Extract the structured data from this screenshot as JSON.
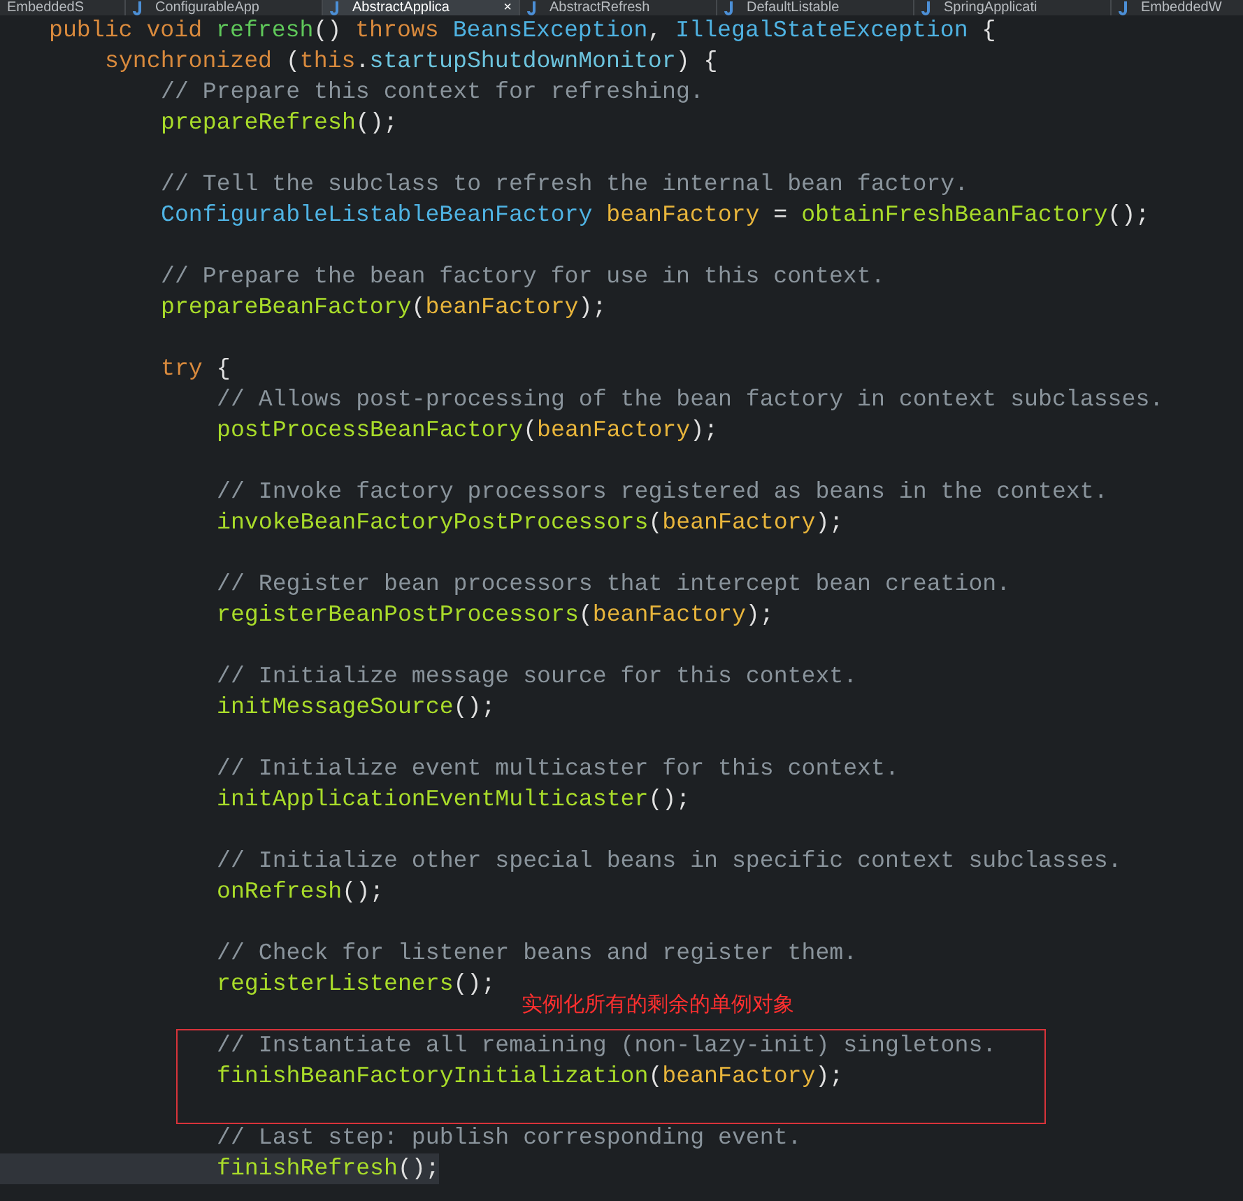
{
  "tabs": [
    {
      "label": "EmbeddedS",
      "selected": false
    },
    {
      "label": "ConfigurableApp",
      "selected": false
    },
    {
      "label": "AbstractApplica",
      "selected": true,
      "close": "×"
    },
    {
      "label": "AbstractRefresh",
      "selected": false
    },
    {
      "label": "DefaultListable",
      "selected": false
    },
    {
      "label": "SpringApplicati",
      "selected": false
    },
    {
      "label": "EmbeddedW",
      "selected": false
    }
  ],
  "annotation": {
    "note": "实例化所有的剩余的单例对象"
  },
  "lines": [
    {
      "kind": "code",
      "current": false,
      "boxed": false,
      "tokens": [
        {
          "kind": "keyword",
          "text": "public void "
        },
        {
          "kind": "declaration",
          "text": "refresh"
        },
        {
          "kind": "plain",
          "text": "() "
        },
        {
          "kind": "keyword",
          "text": "throws "
        },
        {
          "kind": "type",
          "text": "BeansException"
        },
        {
          "kind": "plain",
          "text": ", "
        },
        {
          "kind": "type",
          "text": "IllegalStateException"
        },
        {
          "kind": "plain",
          "text": " {"
        }
      ],
      "children": [
        {
          "kind": "code",
          "current": false,
          "boxed": false,
          "tokens": [
            {
              "kind": "keyword",
              "text": "synchronized"
            },
            {
              "kind": "plain",
              "text": " ("
            },
            {
              "kind": "keyword",
              "text": "this"
            },
            {
              "kind": "plain",
              "text": "."
            },
            {
              "kind": "field",
              "text": "startupShutdownMonitor"
            },
            {
              "kind": "plain",
              "text": ") {"
            }
          ],
          "children": [
            {
              "kind": "code",
              "current": false,
              "boxed": false,
              "tokens": [
                {
                  "kind": "comment",
                  "text": "// Prepare this context for refreshing."
                }
              ]
            },
            {
              "kind": "code",
              "current": false,
              "boxed": false,
              "tokens": [
                {
                  "kind": "method",
                  "text": "prepareRefresh"
                },
                {
                  "kind": "plain",
                  "text": "();"
                }
              ]
            },
            {
              "kind": "blank",
              "current": false,
              "boxed": false
            },
            {
              "kind": "code",
              "current": false,
              "boxed": false,
              "tokens": [
                {
                  "kind": "comment",
                  "text": "// Tell the subclass to refresh the internal bean factory."
                }
              ]
            },
            {
              "kind": "code",
              "current": false,
              "boxed": false,
              "tokens": [
                {
                  "kind": "type",
                  "text": "ConfigurableListableBeanFactory "
                },
                {
                  "kind": "variable",
                  "text": "beanFactory"
                },
                {
                  "kind": "plain",
                  "text": " = "
                },
                {
                  "kind": "method",
                  "text": "obtainFreshBeanFactory"
                },
                {
                  "kind": "plain",
                  "text": "();"
                }
              ]
            },
            {
              "kind": "blank",
              "current": false,
              "boxed": false
            },
            {
              "kind": "code",
              "current": false,
              "boxed": false,
              "tokens": [
                {
                  "kind": "comment",
                  "text": "// Prepare the bean factory for use in this context."
                }
              ]
            },
            {
              "kind": "code",
              "current": false,
              "boxed": false,
              "tokens": [
                {
                  "kind": "method",
                  "text": "prepareBeanFactory"
                },
                {
                  "kind": "plain",
                  "text": "("
                },
                {
                  "kind": "variable",
                  "text": "beanFactory"
                },
                {
                  "kind": "plain",
                  "text": ");"
                }
              ]
            },
            {
              "kind": "blank",
              "current": false,
              "boxed": false
            },
            {
              "kind": "code",
              "current": false,
              "boxed": false,
              "tokens": [
                {
                  "kind": "keyword",
                  "text": "try"
                },
                {
                  "kind": "plain",
                  "text": " {"
                }
              ],
              "children": [
                {
                  "kind": "code",
                  "current": false,
                  "boxed": false,
                  "tokens": [
                    {
                      "kind": "comment",
                      "text": "// Allows post-processing of the bean factory in context subclasses."
                    }
                  ]
                },
                {
                  "kind": "code",
                  "current": false,
                  "boxed": false,
                  "tokens": [
                    {
                      "kind": "method",
                      "text": "postProcessBeanFactory"
                    },
                    {
                      "kind": "plain",
                      "text": "("
                    },
                    {
                      "kind": "variable",
                      "text": "beanFactory"
                    },
                    {
                      "kind": "plain",
                      "text": ");"
                    }
                  ]
                },
                {
                  "kind": "blank",
                  "current": false,
                  "boxed": false
                },
                {
                  "kind": "code",
                  "current": false,
                  "boxed": false,
                  "tokens": [
                    {
                      "kind": "comment",
                      "text": "// Invoke factory processors registered as beans in the context."
                    }
                  ]
                },
                {
                  "kind": "code",
                  "current": false,
                  "boxed": false,
                  "tokens": [
                    {
                      "kind": "method",
                      "text": "invokeBeanFactoryPostProcessors"
                    },
                    {
                      "kind": "plain",
                      "text": "("
                    },
                    {
                      "kind": "variable",
                      "text": "beanFactory"
                    },
                    {
                      "kind": "plain",
                      "text": ");"
                    }
                  ]
                },
                {
                  "kind": "blank",
                  "current": false,
                  "boxed": false
                },
                {
                  "kind": "code",
                  "current": false,
                  "boxed": false,
                  "tokens": [
                    {
                      "kind": "comment",
                      "text": "// Register bean processors that intercept bean creation."
                    }
                  ]
                },
                {
                  "kind": "code",
                  "current": false,
                  "boxed": false,
                  "tokens": [
                    {
                      "kind": "method",
                      "text": "registerBeanPostProcessors"
                    },
                    {
                      "kind": "plain",
                      "text": "("
                    },
                    {
                      "kind": "variable",
                      "text": "beanFactory"
                    },
                    {
                      "kind": "plain",
                      "text": ");"
                    }
                  ]
                },
                {
                  "kind": "blank",
                  "current": false,
                  "boxed": false
                },
                {
                  "kind": "code",
                  "current": false,
                  "boxed": false,
                  "tokens": [
                    {
                      "kind": "comment",
                      "text": "// Initialize message source for this context."
                    }
                  ]
                },
                {
                  "kind": "code",
                  "current": false,
                  "boxed": false,
                  "tokens": [
                    {
                      "kind": "method",
                      "text": "initMessageSource"
                    },
                    {
                      "kind": "plain",
                      "text": "();"
                    }
                  ]
                },
                {
                  "kind": "blank",
                  "current": false,
                  "boxed": false
                },
                {
                  "kind": "code",
                  "current": false,
                  "boxed": false,
                  "tokens": [
                    {
                      "kind": "comment",
                      "text": "// Initialize event multicaster for this context."
                    }
                  ]
                },
                {
                  "kind": "code",
                  "current": false,
                  "boxed": false,
                  "tokens": [
                    {
                      "kind": "method",
                      "text": "initApplicationEventMulticaster"
                    },
                    {
                      "kind": "plain",
                      "text": "();"
                    }
                  ]
                },
                {
                  "kind": "blank",
                  "current": false,
                  "boxed": false
                },
                {
                  "kind": "code",
                  "current": false,
                  "boxed": false,
                  "tokens": [
                    {
                      "kind": "comment",
                      "text": "// Initialize other special beans in specific context subclasses."
                    }
                  ]
                },
                {
                  "kind": "code",
                  "current": false,
                  "boxed": false,
                  "tokens": [
                    {
                      "kind": "method",
                      "text": "onRefresh"
                    },
                    {
                      "kind": "plain",
                      "text": "();"
                    }
                  ]
                },
                {
                  "kind": "blank",
                  "current": false,
                  "boxed": false
                },
                {
                  "kind": "code",
                  "current": false,
                  "boxed": false,
                  "tokens": [
                    {
                      "kind": "comment",
                      "text": "// Check for listener beans and register them."
                    }
                  ]
                },
                {
                  "kind": "code",
                  "current": false,
                  "boxed": false,
                  "tokens": [
                    {
                      "kind": "method",
                      "text": "registerListeners"
                    },
                    {
                      "kind": "plain",
                      "text": "();"
                    }
                  ]
                },
                {
                  "kind": "blank",
                  "current": false,
                  "boxed": false
                },
                {
                  "kind": "code",
                  "current": false,
                  "boxed": true,
                  "tokens": [
                    {
                      "kind": "comment",
                      "text": "// Instantiate all remaining (non-lazy-init) singletons."
                    }
                  ]
                },
                {
                  "kind": "code",
                  "current": false,
                  "boxed": true,
                  "tokens": [
                    {
                      "kind": "method",
                      "text": "finishBeanFactoryInitialization"
                    },
                    {
                      "kind": "plain",
                      "text": "("
                    },
                    {
                      "kind": "variable",
                      "text": "beanFactory"
                    },
                    {
                      "kind": "plain",
                      "text": ");"
                    }
                  ]
                },
                {
                  "kind": "blank",
                  "current": false,
                  "boxed": true
                },
                {
                  "kind": "code",
                  "current": false,
                  "boxed": false,
                  "tokens": [
                    {
                      "kind": "comment",
                      "text": "// Last step: publish corresponding event."
                    }
                  ]
                },
                {
                  "kind": "code",
                  "current": true,
                  "boxed": false,
                  "tokens": [
                    {
                      "kind": "method",
                      "text": "finishRefresh"
                    },
                    {
                      "kind": "plain",
                      "text": "();"
                    }
                  ]
                }
              ]
            }
          ]
        }
      ]
    }
  ]
}
